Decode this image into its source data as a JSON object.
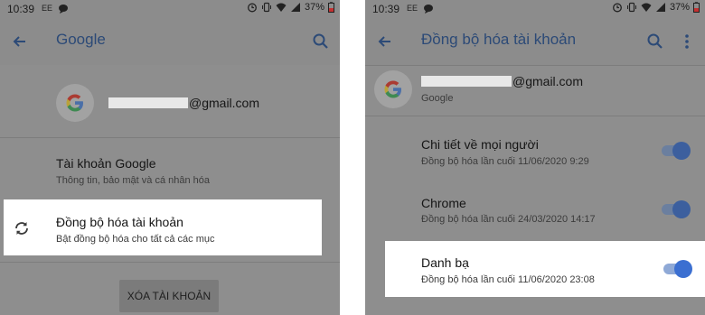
{
  "status_bar": {
    "time": "10:39",
    "notif_label": "EE",
    "battery": "37%"
  },
  "left_screen": {
    "title": "Google",
    "email_suffix": "@gmail.com",
    "google_account": {
      "title": "Tài khoản Google",
      "subtitle": "Thông tin, bảo mật và cá nhân hóa"
    },
    "account_sync": {
      "title": "Đồng bộ hóa tài khoản",
      "subtitle": "Bật đồng bộ hóa cho tất cả các mục"
    },
    "remove_button": "XÓA TÀI KHOẢN"
  },
  "right_screen": {
    "title": "Đồng bộ hóa tài khoản",
    "email_suffix": "@gmail.com",
    "account_type": "Google",
    "sync_items": [
      {
        "title": "Chi tiết về mọi người",
        "subtitle": "Đồng bộ hóa lần cuối 11/06/2020 9:29",
        "enabled": true
      },
      {
        "title": "Chrome",
        "subtitle": "Đồng bộ hóa lần cuối 24/03/2020 14:17",
        "enabled": true
      },
      {
        "title": "Danh bạ",
        "subtitle": "Đồng bộ hóa lần cuối 11/06/2020 23:08",
        "enabled": true
      }
    ]
  },
  "icons": {
    "back": "arrow-back-icon",
    "search": "search-icon",
    "more": "more-vert-icon",
    "sync": "sync-icon",
    "google_logo": "google-logo-icon"
  },
  "colors": {
    "title_blue": "#2c4a77",
    "toggle_track": "#8fa9d6",
    "toggle_thumb": "#3b6fd1",
    "toggle_thumb_dim": "#3c5f9e"
  }
}
